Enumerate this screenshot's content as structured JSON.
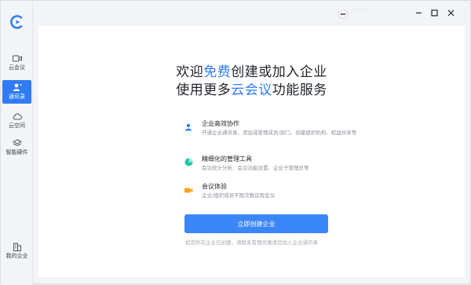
{
  "titlebar": {
    "user_name": "···········",
    "minimize_icon": "minimize-icon",
    "maximize_icon": "maximize-icon",
    "close_icon": "close-icon"
  },
  "sidebar": {
    "items": [
      {
        "label": "云会议",
        "icon": "video-camera-icon",
        "active": false
      },
      {
        "label": "通讯录",
        "icon": "contacts-icon",
        "active": true
      },
      {
        "label": "云空间",
        "icon": "cloud-icon",
        "active": false
      },
      {
        "label": "智能硬件",
        "icon": "layers-icon",
        "active": false
      }
    ],
    "bottom_item": {
      "label": "我的企业",
      "icon": "building-icon"
    }
  },
  "main": {
    "headline_line1": {
      "pre": "欢迎",
      "highlight": "免费",
      "post": "创建或加入企业"
    },
    "headline_line2": {
      "pre": "使用更多",
      "highlight": "云会议",
      "post": "功能服务"
    },
    "features": [
      {
        "title": "企业高效协作",
        "desc": "开通企业通讯录、添加或管理成员/部门、创建组织机构、权益共享等",
        "icon": "person-icon",
        "color": "#2f7cf6"
      },
      {
        "title": "精细化的管理工具",
        "desc": "会议统计分析、会议功能设置、企业子管理员等",
        "icon": "pie-chart-icon",
        "color": "#1fc6a8"
      },
      {
        "title": "会议体验",
        "desc": "企业/组织成员不限次数远程会议",
        "icon": "video-icon",
        "color": "#f6a623"
      }
    ],
    "cta_label": "立即创建企业",
    "hint": "如您所在企业已创建，请联系管理员邀请您加入企业通讯录"
  },
  "colors": {
    "accent": "#2f7cf6",
    "button": "#3b86f7"
  }
}
